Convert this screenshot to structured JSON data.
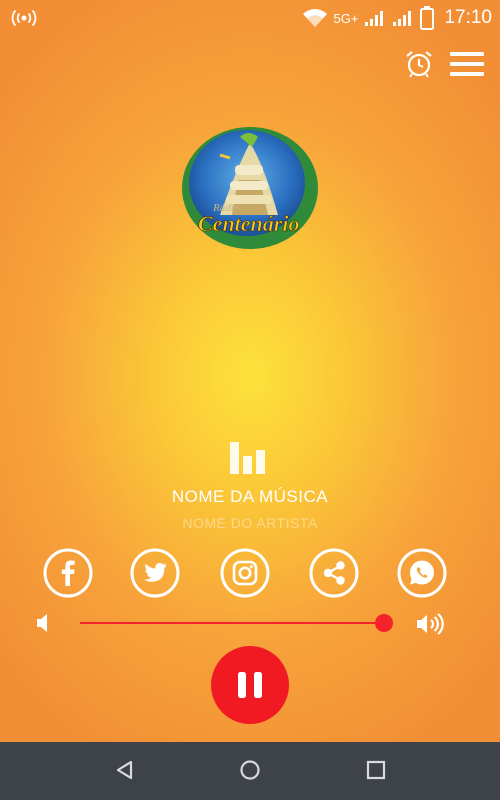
{
  "status_bar": {
    "network_label": "5G+",
    "time": "17:10",
    "icons": [
      "broadcast-icon",
      "wifi-icon",
      "signal-icon",
      "signal-icon",
      "battery-icon"
    ]
  },
  "toolbar": {
    "icons": [
      "alarm-clock-icon",
      "menu-icon"
    ]
  },
  "station": {
    "logo_icon": "station-logo",
    "logo_text_top": "Rádio",
    "logo_text_main": "Centenário"
  },
  "player": {
    "song_title": "NOME DA MÚSICA",
    "artist_name": "NOME DO ARTISTA",
    "state": "playing",
    "play_button_icon": "pause-icon"
  },
  "social": [
    "facebook-icon",
    "twitter-icon",
    "instagram-icon",
    "share-icon",
    "whatsapp-icon"
  ],
  "volume": {
    "level": 1.0,
    "low_icon": "volume-low-icon",
    "high_icon": "volume-high-icon"
  },
  "colors": {
    "accent": "#f21a22",
    "background_outer": "#f28f36",
    "background_center": "#fde23a",
    "nav_bar": "#3e4349"
  },
  "system_nav": [
    "back-icon",
    "home-icon",
    "recents-icon"
  ]
}
